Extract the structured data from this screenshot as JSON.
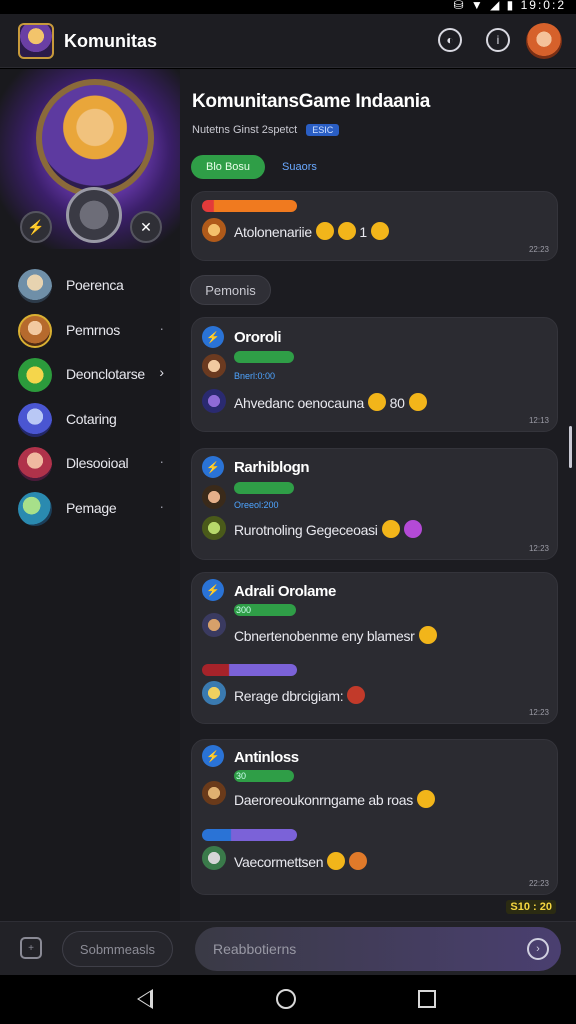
{
  "status_bar": {
    "time": "19:0:2"
  },
  "app": {
    "title": "Komunitas"
  },
  "sidebar": {
    "items": [
      {
        "label": "Poerenca",
        "arrow": ""
      },
      {
        "label": "Pemrnos",
        "arrow": "·"
      },
      {
        "label": "Deonclotarse",
        "arrow": "›"
      },
      {
        "label": "Cotaring",
        "arrow": ""
      },
      {
        "label": "Dlesooioal",
        "arrow": "·"
      },
      {
        "label": "Pemage",
        "arrow": "·"
      }
    ]
  },
  "group": {
    "title": "KomunitansGame Indaania",
    "meta": "Nutetns Ginst  2spetct",
    "meta_tag": "ESIC",
    "join_label": "Blo Bosu",
    "link_label": "Suaors"
  },
  "chip_label": "Pemonis",
  "cards": [
    {
      "name": "",
      "bar_label": "",
      "messages": [
        {
          "text": "Atolonenariie",
          "suffix": "1"
        }
      ],
      "timestamp": "22:23"
    },
    {
      "name": "Ororoli",
      "bar_label": "Bnerl:0:00",
      "messages": [
        {
          "text": "Ahvedanc oenocauna",
          "suffix": "80"
        }
      ],
      "timestamp": "12:13"
    },
    {
      "name": "Rarhiblogn",
      "bar_label": "Oreeol:200",
      "messages": [
        {
          "text": "Rurotnoling Gegeceoasi",
          "suffix": ""
        }
      ],
      "timestamp": "12:23"
    },
    {
      "name": "Adrali Orolame",
      "bar_label": "300",
      "messages": [
        {
          "text": "Cbnertenobenme eny blamesr",
          "suffix": ""
        },
        {
          "text": "Rerage dbrcigiam:",
          "suffix": ""
        }
      ],
      "timestamp": "12:23"
    },
    {
      "name": "Antinloss",
      "bar_label": "30",
      "messages": [
        {
          "text": "Daeroreoukonrngame ab roas",
          "suffix": ""
        },
        {
          "text": "Vaecormettsen",
          "suffix": ""
        }
      ],
      "timestamp": "22:23"
    }
  ],
  "composer": {
    "left_pill": "Sobmmeasls",
    "placeholder": "Reabbotierns",
    "time_badge": "S10 : 20"
  },
  "colors": {
    "accent_green": "#2f9e47",
    "accent_blue": "#2a73d6",
    "bar_orange": "#f07a1f",
    "bar_purple": "#7b62d8"
  }
}
